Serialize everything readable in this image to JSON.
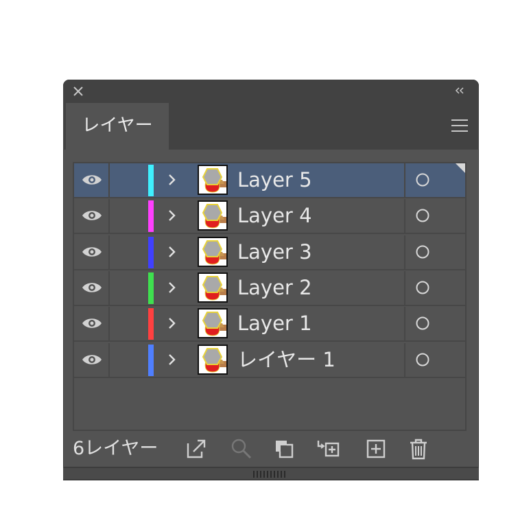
{
  "panel": {
    "tab_label": "レイヤー",
    "footer_count": "6レイヤー",
    "colors": {
      "selected_row": "#4b5e7a",
      "panel_bg": "#535353"
    },
    "icons": {
      "titlebar": [
        "close-icon",
        "collapse-icon"
      ],
      "tab": [
        "panel-menu-icon"
      ],
      "footer": [
        "export-icon",
        "search-icon",
        "clipping-mask-icon",
        "new-sublayer-icon",
        "new-layer-icon",
        "trash-icon"
      ]
    }
  },
  "layers": [
    {
      "name": "Layer 5",
      "color": "#3ff0ff",
      "selected": true
    },
    {
      "name": "Layer 4",
      "color": "#ff3fff",
      "selected": false
    },
    {
      "name": "Layer 3",
      "color": "#4040ff",
      "selected": false
    },
    {
      "name": "Layer 2",
      "color": "#3fe04f",
      "selected": false
    },
    {
      "name": "Layer 1",
      "color": "#ff4040",
      "selected": false
    },
    {
      "name": "レイヤー 1",
      "color": "#4f7fff",
      "selected": false
    }
  ]
}
